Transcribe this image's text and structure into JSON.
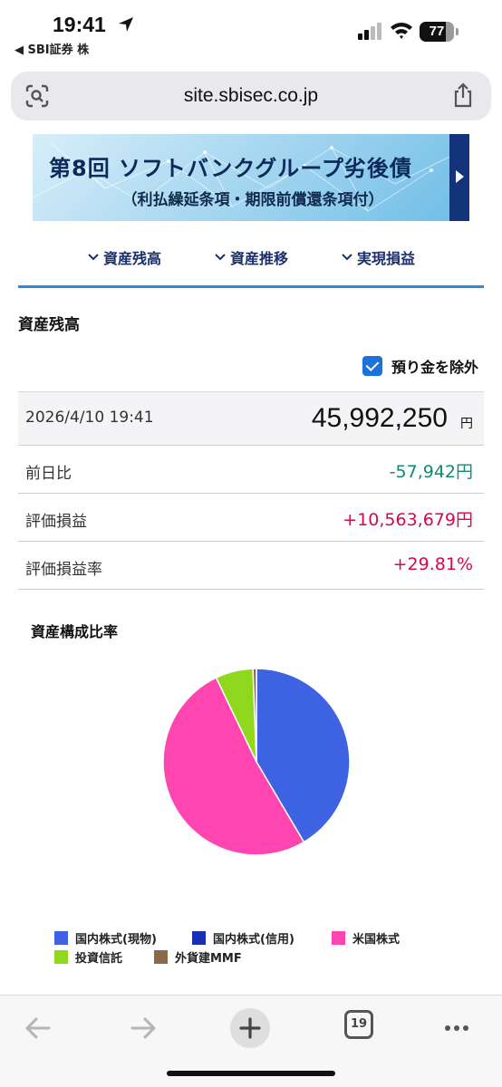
{
  "status_bar": {
    "time": "19:41",
    "back_app": "◀ SBI証券 株",
    "battery_percent": "77",
    "battery_level": 0.77
  },
  "browser": {
    "url": "site.sbisec.co.jp",
    "tab_count": "19"
  },
  "banner": {
    "title": "第8回 ソフトバンクグループ劣後債",
    "subtitle": "（利払繰延条項・期限前償還条項付）"
  },
  "anchor_nav": {
    "items": [
      {
        "label": "資産残高"
      },
      {
        "label": "資産推移"
      },
      {
        "label": "実現損益"
      }
    ]
  },
  "section": {
    "title": "資産残高",
    "exclude_deposit_label": "預り金を除外",
    "exclude_deposit_checked": true
  },
  "summary": {
    "datetime": "2026/4/10 19:41",
    "total": "45,992,250",
    "total_unit": "円",
    "rows": [
      {
        "label": "前日比",
        "value": "-57,942円",
        "color": "#0f8b72"
      },
      {
        "label": "評価損益",
        "value": "+10,563,679円",
        "color": "#d6084d"
      },
      {
        "label": "評価損益率",
        "value": "+29.81%",
        "color": "#d6084d"
      }
    ]
  },
  "composition": {
    "title": "資産構成比率",
    "legend": [
      {
        "label": "国内株式(現物)",
        "color": "#3d63e3"
      },
      {
        "label": "国内株式(信用)",
        "color": "#1a2eb3"
      },
      {
        "label": "米国株式",
        "color": "#ff45b0"
      },
      {
        "label": "投資信託",
        "color": "#8fd81e"
      },
      {
        "label": "外貨建MMF",
        "color": "#8a6a4d"
      }
    ]
  },
  "chart_data": {
    "type": "pie",
    "title": "資産構成比率",
    "categories": [
      "国内株式(現物)",
      "国内株式(信用)",
      "米国株式",
      "投資信託",
      "外貨建MMF"
    ],
    "values": [
      41.5,
      0,
      51.4,
      6.5,
      0.6
    ],
    "colors": [
      "#3d63e3",
      "#1a2eb3",
      "#ff45b0",
      "#8fd81e",
      "#8a6a4d"
    ],
    "legend_position": "bottom"
  }
}
